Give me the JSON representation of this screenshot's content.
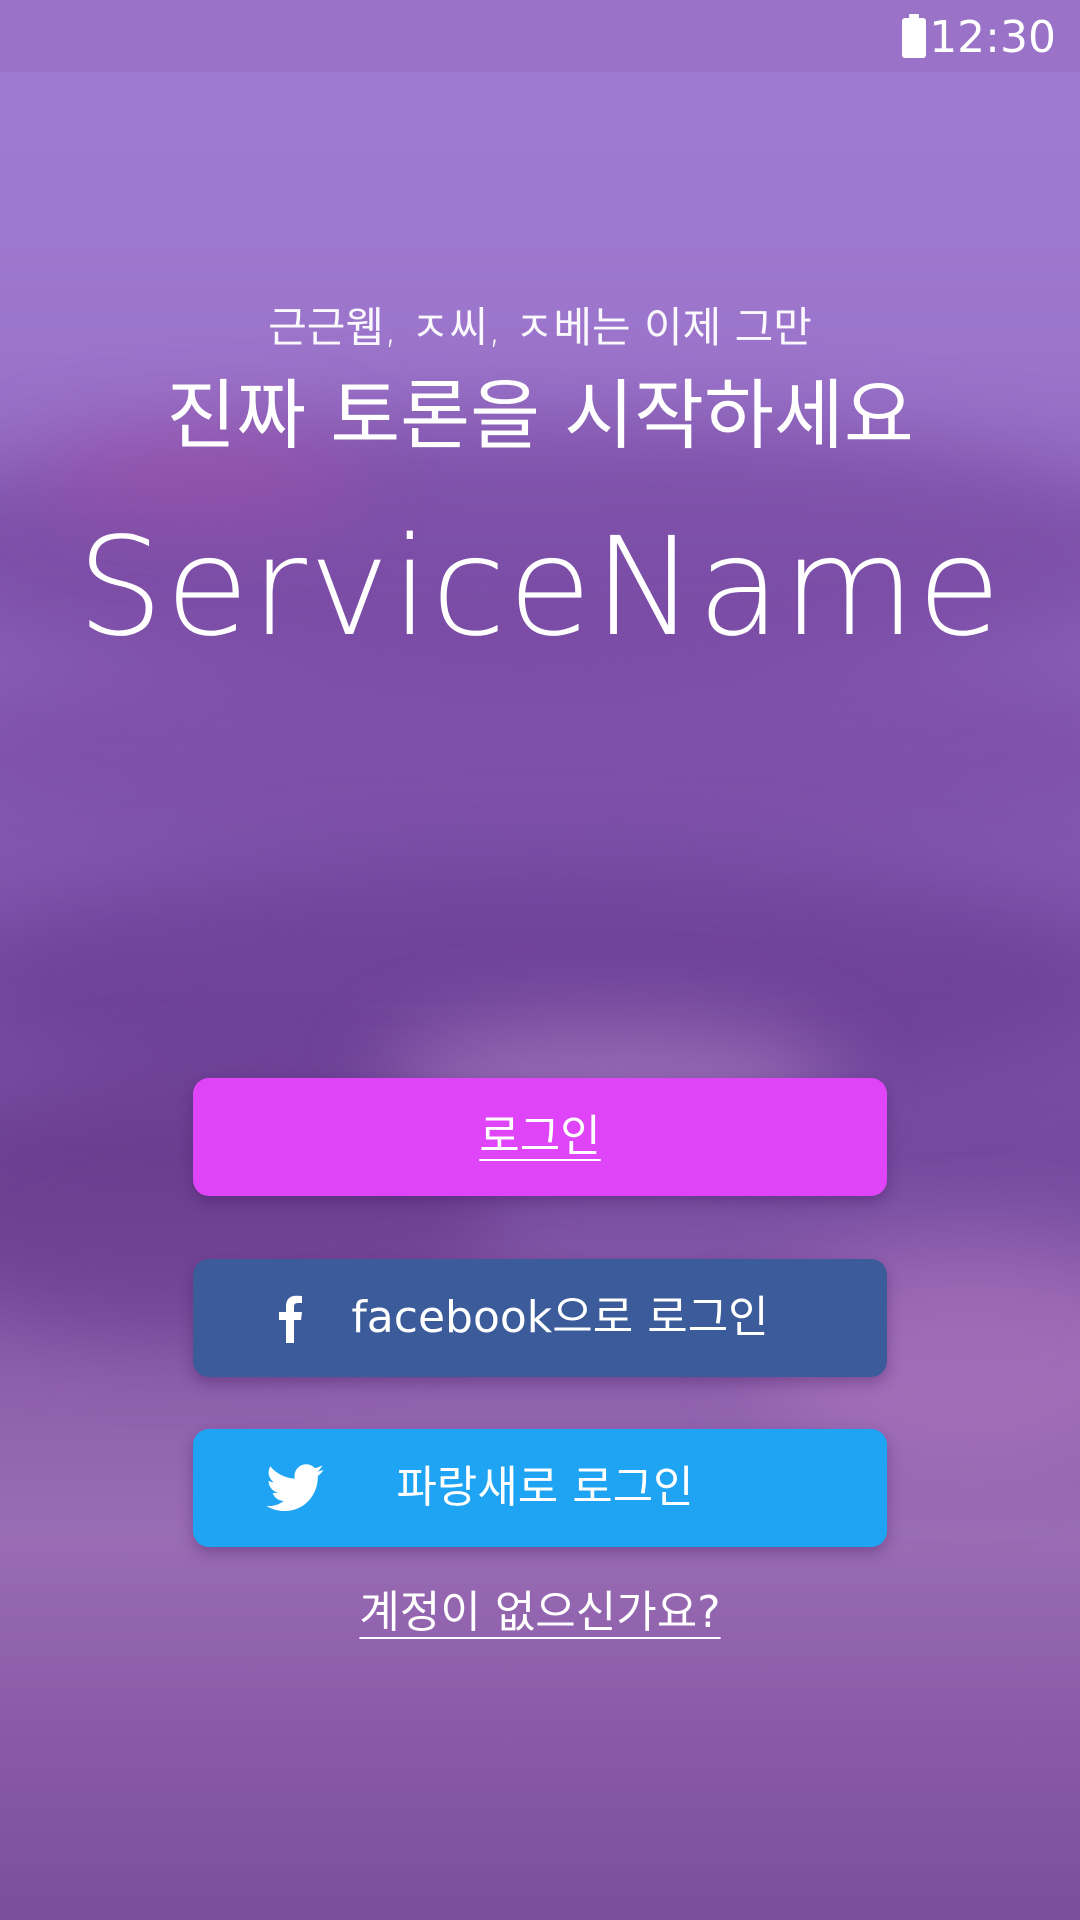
{
  "status_bar": {
    "time": "12:30",
    "icons": [
      "battery-icon"
    ]
  },
  "hero": {
    "subtitle": "근근웹, ㅈ씨, ㅈ베는 이제 그만",
    "headline": "진짜 토론을 시작하세요",
    "brand_name": "ServiceName"
  },
  "buttons": {
    "login_label": "로그인",
    "facebook_label": "facebook으로 로그인",
    "twitter_label": "파랑새로 로그인"
  },
  "signup": {
    "link_label": "계정이 없으신가요?"
  },
  "colors": {
    "login_button": "#e044f8",
    "facebook_button": "#3c5b9a",
    "twitter_button": "#1ea4f2",
    "status_bar": "#9a72c8"
  }
}
